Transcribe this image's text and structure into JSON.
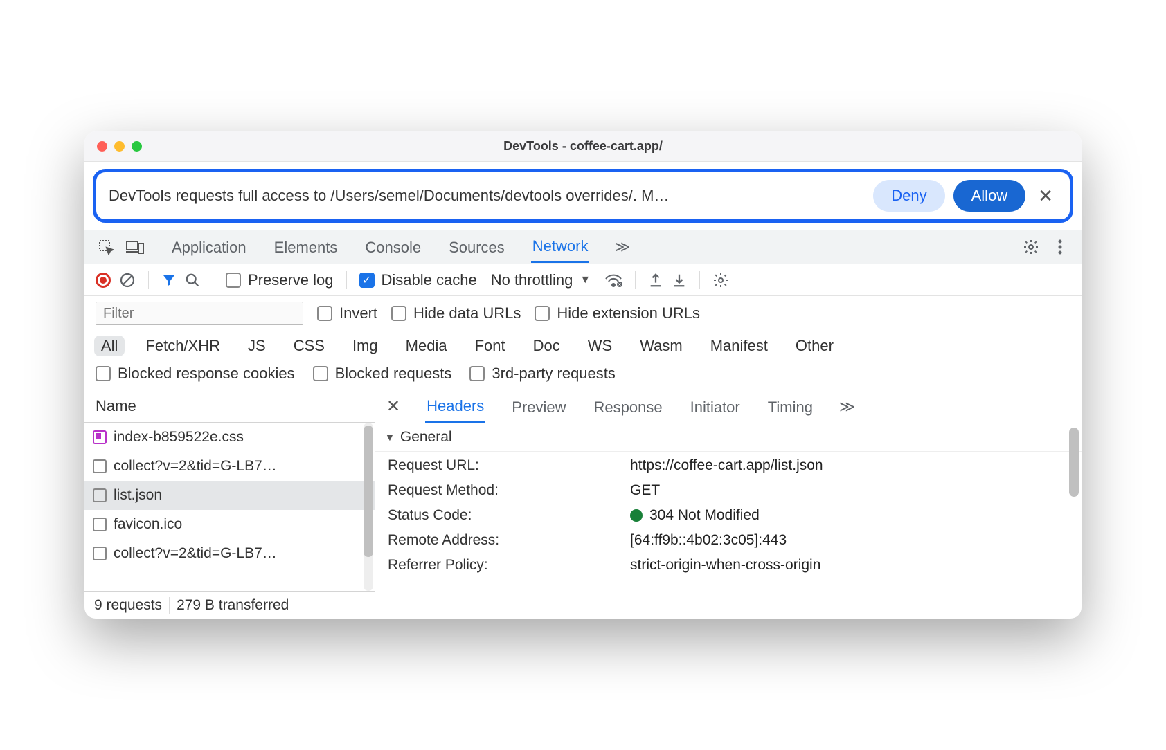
{
  "window_title": "DevTools - coffee-cart.app/",
  "permission": {
    "text": "DevTools requests full access to /Users/semel/Documents/devtools overrides/. M…",
    "deny": "Deny",
    "allow": "Allow"
  },
  "tabs": {
    "items": [
      "Application",
      "Elements",
      "Console",
      "Sources",
      "Network"
    ],
    "active": "Network"
  },
  "toolbar": {
    "preserve_log": "Preserve log",
    "disable_cache": "Disable cache",
    "throttling": "No throttling"
  },
  "filter": {
    "placeholder": "Filter",
    "invert": "Invert",
    "hide_data": "Hide data URLs",
    "hide_ext": "Hide extension URLs"
  },
  "types": [
    "All",
    "Fetch/XHR",
    "JS",
    "CSS",
    "Img",
    "Media",
    "Font",
    "Doc",
    "WS",
    "Wasm",
    "Manifest",
    "Other"
  ],
  "options": {
    "blocked_cookies": "Blocked response cookies",
    "blocked_req": "Blocked requests",
    "third_party": "3rd-party requests"
  },
  "sidebar": {
    "header": "Name",
    "rows": [
      {
        "name": "index-b859522e.css",
        "override": true
      },
      {
        "name": "collect?v=2&tid=G-LB7…",
        "override": false
      },
      {
        "name": "list.json",
        "override": false,
        "selected": true
      },
      {
        "name": "favicon.ico",
        "override": false
      },
      {
        "name": "collect?v=2&tid=G-LB7…",
        "override": false
      }
    ],
    "footer_requests": "9 requests",
    "footer_transfer": "279 B transferred"
  },
  "detail_tabs": {
    "items": [
      "Headers",
      "Preview",
      "Response",
      "Initiator",
      "Timing"
    ],
    "active": "Headers"
  },
  "general": {
    "header": "General",
    "rows": [
      {
        "key": "Request URL:",
        "val": "https://coffee-cart.app/list.json"
      },
      {
        "key": "Request Method:",
        "val": "GET"
      },
      {
        "key": "Status Code:",
        "val": "304 Not Modified",
        "status": true
      },
      {
        "key": "Remote Address:",
        "val": "[64:ff9b::4b02:3c05]:443"
      },
      {
        "key": "Referrer Policy:",
        "val": "strict-origin-when-cross-origin"
      }
    ]
  }
}
